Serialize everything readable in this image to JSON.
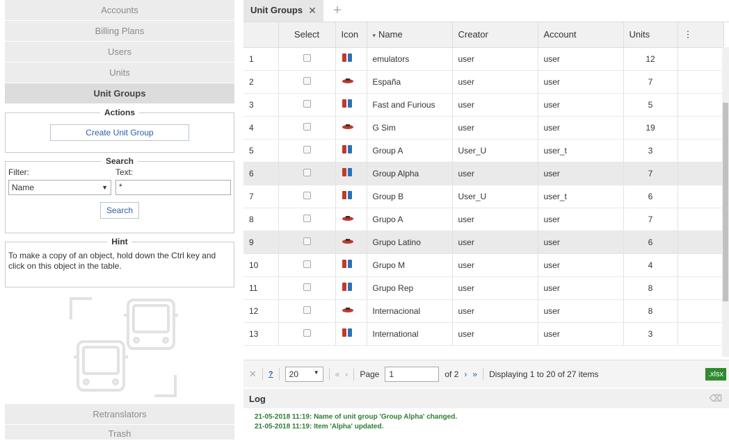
{
  "sidebar": {
    "nav": [
      "Accounts",
      "Billing Plans",
      "Users",
      "Units",
      "Unit Groups"
    ],
    "actions": {
      "title": "Actions",
      "create_label": "Create Unit Group"
    },
    "search": {
      "title": "Search",
      "filter_label": "Filter:",
      "text_label": "Text:",
      "filter_value": "Name",
      "text_value": "*",
      "button_label": "Search"
    },
    "hint": {
      "title": "Hint",
      "text": "To make a copy of an object, hold down the Ctrl key and click on this object in the table."
    },
    "bottom_nav": [
      "Retranslators",
      "Trash"
    ]
  },
  "tabs": {
    "active": "Unit Groups",
    "close": "✕",
    "add": "+"
  },
  "table": {
    "headers": {
      "select": "Select",
      "icon": "Icon",
      "name": "Name",
      "name_sort": "▾",
      "creator": "Creator",
      "account": "Account",
      "units": "Units",
      "menu": "⋮"
    },
    "rows": [
      {
        "n": "1",
        "name": "emulators",
        "creator": "user",
        "account": "user",
        "units": "12",
        "icon": "unit-icon"
      },
      {
        "n": "2",
        "name": "España",
        "creator": "user",
        "account": "user",
        "units": "7",
        "icon": "car-icon"
      },
      {
        "n": "3",
        "name": "Fast and Furious",
        "creator": "user",
        "account": "user",
        "units": "5",
        "icon": "unit-icon"
      },
      {
        "n": "4",
        "name": "G Sim",
        "creator": "user",
        "account": "user",
        "units": "19",
        "icon": "car-icon"
      },
      {
        "n": "5",
        "name": "Group A",
        "creator": "User_U",
        "account": "user_t",
        "units": "3",
        "icon": "unit-icon"
      },
      {
        "n": "6",
        "name": "Group Alpha",
        "creator": "user",
        "account": "user",
        "units": "7",
        "icon": "unit-icon"
      },
      {
        "n": "7",
        "name": "Group B",
        "creator": "User_U",
        "account": "user_t",
        "units": "6",
        "icon": "unit-icon"
      },
      {
        "n": "8",
        "name": "Grupo A",
        "creator": "user",
        "account": "user",
        "units": "7",
        "icon": "car-icon"
      },
      {
        "n": "9",
        "name": "Grupo Latino",
        "creator": "user",
        "account": "user",
        "units": "6",
        "icon": "car-icon"
      },
      {
        "n": "10",
        "name": "Grupo M",
        "creator": "user",
        "account": "user",
        "units": "4",
        "icon": "unit-icon"
      },
      {
        "n": "11",
        "name": "Grupo Rep",
        "creator": "user",
        "account": "user",
        "units": "8",
        "icon": "unit-icon"
      },
      {
        "n": "12",
        "name": "Internacional",
        "creator": "user",
        "account": "user",
        "units": "8",
        "icon": "car-icon"
      },
      {
        "n": "13",
        "name": "International",
        "creator": "user",
        "account": "user",
        "units": "3",
        "icon": "unit-icon"
      }
    ]
  },
  "pager": {
    "page_size": "20",
    "page_label": "Page",
    "page": "1",
    "of": "of 2",
    "display": "Displaying 1 to 20 of 27 items",
    "xlsx": ".xlsx",
    "first": "«",
    "prev": "‹",
    "next": "›",
    "last": "»",
    "close": "✕",
    "help": "?"
  },
  "log": {
    "title": "Log",
    "entries": [
      "21-05-2018 11:19: Name of unit group 'Group Alpha' changed.",
      "21-05-2018 11:19: Item 'Alpha' updated."
    ]
  },
  "colors": {
    "accent": "#2e8b2e",
    "link": "#2a5ea8"
  }
}
